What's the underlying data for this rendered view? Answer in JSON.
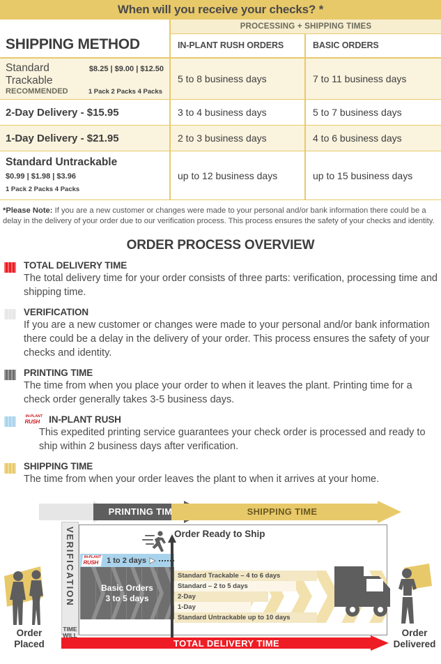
{
  "header": {
    "title": "When will you receive your checks? *"
  },
  "table": {
    "col_method_header": "SHIPPING METHOD",
    "group_header": "PROCESSING + SHIPPING TIMES",
    "col_rush_header": "IN-PLANT RUSH ORDERS",
    "col_basic_header": "BASIC ORDERS",
    "rows": [
      {
        "name": "Standard Trackable",
        "prices": "$8.25 | $9.00 | $12.50",
        "recommended": "RECOMMENDED",
        "packs": "1 Pack  2 Packs  4 Packs",
        "rush": "5 to 8 business days",
        "basic": "7 to 11 business days"
      },
      {
        "name": "2-Day Delivery - $15.95",
        "prices": "",
        "recommended": "",
        "packs": "",
        "rush": "3 to 4 business days",
        "basic": "5 to 7 business days"
      },
      {
        "name": "1-Day Delivery - $21.95",
        "prices": "",
        "recommended": "",
        "packs": "",
        "rush": "2 to 3 business days",
        "basic": "4 to 6 business days"
      },
      {
        "name": "Standard Untrackable",
        "prices": "$0.99 | $1.98 | $3.96",
        "recommended": "",
        "packs": "1 Pack  2 Packs  4 Packs",
        "rush": "up to 12 business days",
        "basic": "up to 15 business days"
      }
    ]
  },
  "note": {
    "label": "*Please Note:",
    "body": "If you are a new customer or changes were made to your personal and/or bank information there could be a delay in the delivery of your order due to our verification process.  This process ensures the safety of your checks and identity."
  },
  "overview": {
    "title": "ORDER PROCESS OVERVIEW",
    "items": [
      {
        "swatch_color": "#ee1c24",
        "heading": "TOTAL DELIVERY TIME",
        "text": "The total delivery time for your order consists of three parts: verification, processing time and shipping time.",
        "badge": ""
      },
      {
        "swatch_color": "#e6e6e6",
        "heading": "VERIFICATION",
        "text": "If you are a new customer or changes were made to your personal and/or bank information there could be a delay in the delivery of your order. This process ensures the safety of your checks and identity.",
        "badge": ""
      },
      {
        "swatch_color": "#6e6e6e",
        "heading": "PRINTING TIME",
        "text": "The time from when you place your order to when it leaves the plant. Printing time for a check order generally takes 3-5 business days.",
        "badge": ""
      },
      {
        "swatch_color": "#a9d3ec",
        "heading": "IN-PLANT RUSH",
        "text": "This expedited printing service guarantees your check order is processed and ready to ship within 2 business days after verification.",
        "badge": "IN-PLANT RUSH"
      },
      {
        "swatch_color": "#e8c96a",
        "heading": "SHIPPING TIME",
        "text": "The time from when your order leaves the plant to when it arrives at your home.",
        "badge": ""
      }
    ]
  },
  "diagram": {
    "printing_time_label": "PRINTING TIME",
    "shipping_time_label": "SHIPPING TIME",
    "total_delivery_label": "TOTAL DELIVERY TIME",
    "verification_label": "VERIFICATION",
    "time_will_vary": "TIME WILL VARY",
    "rush_badge": "IN-PLANT RUSH",
    "rush_days": "1 to 2 days",
    "basic_orders_label": "Basic Orders",
    "basic_orders_days": "3 to 5 days",
    "order_ready_label": "Order Ready to Ship",
    "order_placed_label": "Order Placed",
    "order_delivered_label": "Order Delivered",
    "shipping_rows": [
      {
        "label": "Standard Trackable – 4 to 6 days",
        "tint": true
      },
      {
        "label": "Standard – 2 to 5 days",
        "tint": false
      },
      {
        "label": "2-Day",
        "tint": true
      },
      {
        "label": "1-Day",
        "tint": false
      },
      {
        "label": "Standard Untrackable up to 10 days",
        "tint": true
      }
    ]
  },
  "colors": {
    "brand_gold": "#e8c96a",
    "tint_gold": "#faf3de",
    "red": "#ee1c24",
    "gray_dark": "#6e6e6e",
    "gray_light": "#e6e6e6",
    "rush_blue": "#a9d3ec"
  }
}
